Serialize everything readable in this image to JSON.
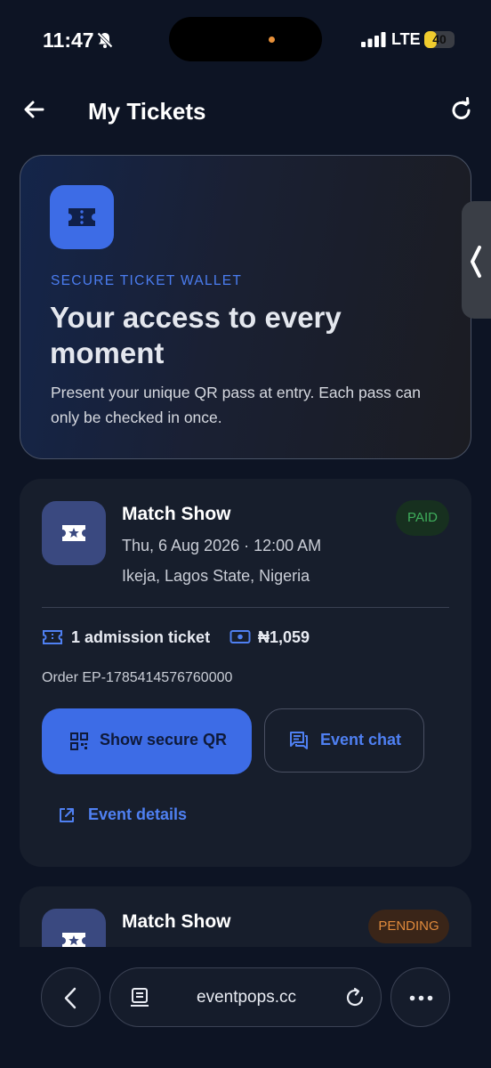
{
  "status_bar": {
    "time": "11:47",
    "network": "LTE",
    "battery": "40",
    "battery_level": 0.4
  },
  "header": {
    "title": "My Tickets"
  },
  "hero": {
    "eyebrow": "SECURE TICKET WALLET",
    "title": "Your access to every moment",
    "description": "Present your unique QR pass at entry. Each pass can only be checked in once."
  },
  "tickets": [
    {
      "title": "Match Show",
      "status": "PAID",
      "date": "Thu, 6 Aug 2026 · 12:00 AM",
      "location": "Ikeja, Lagos State, Nigeria",
      "admission": "1 admission ticket",
      "price": "₦1,059",
      "order": "Order EP-1785414576760000",
      "qr_label": "Show secure QR",
      "chat_label": "Event chat",
      "details_label": "Event details"
    },
    {
      "title": "Match Show",
      "status": "PENDING"
    }
  ],
  "browser": {
    "url": "eventpops.cc"
  },
  "colors": {
    "background": "#0d1424",
    "accent": "#3d6ce6",
    "paid": "#3fae5c",
    "pending": "#e08a3c"
  }
}
